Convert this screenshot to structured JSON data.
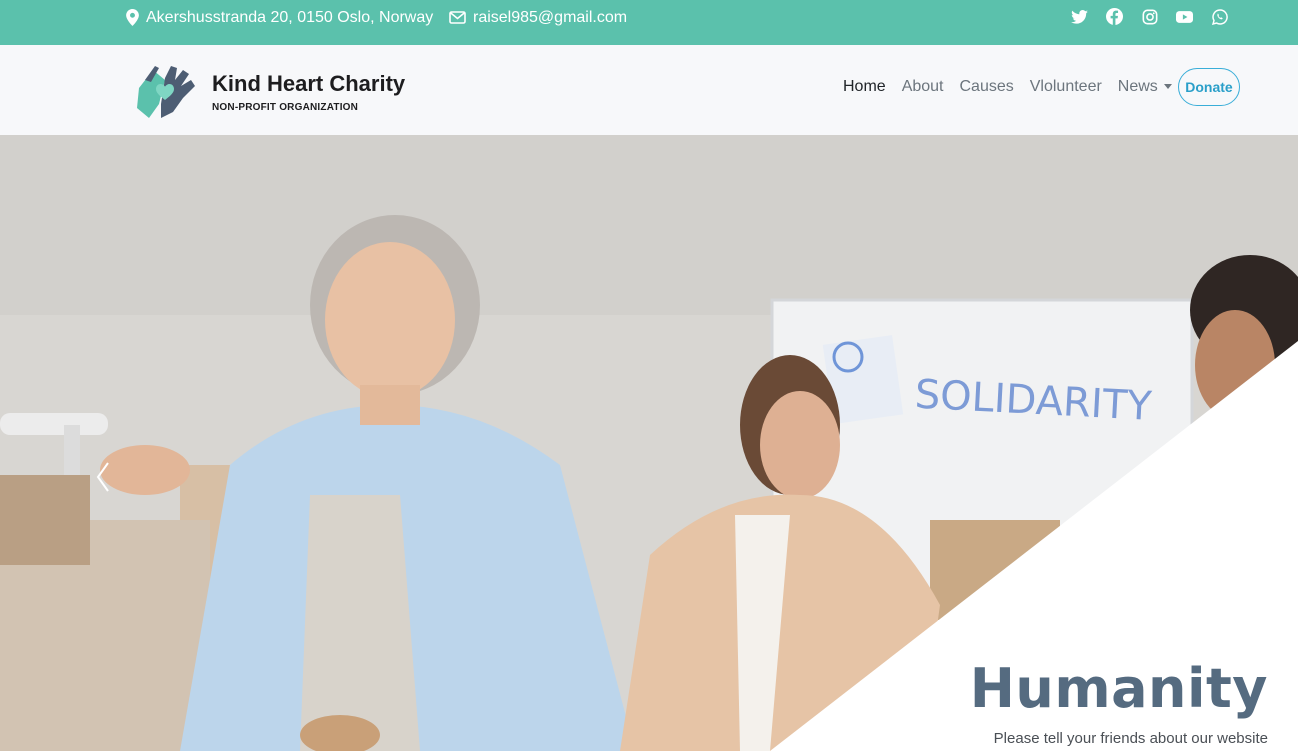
{
  "topbar": {
    "address": "Akershusstranda 20, 0150 Oslo, Norway",
    "email": "raisel985@gmail.com",
    "social_icons": [
      "twitter-icon",
      "facebook-icon",
      "instagram-icon",
      "youtube-icon",
      "whatsapp-icon"
    ]
  },
  "navbar": {
    "brand_name": "Kind Heart Charity",
    "brand_sub": "NON-PROFIT ORGANIZATION",
    "items": [
      {
        "label": "Home",
        "active": true
      },
      {
        "label": "About"
      },
      {
        "label": "Causes"
      },
      {
        "label": "Vlolunteer"
      },
      {
        "label": "News",
        "dropdown": true
      }
    ],
    "donate_label": "Donate"
  },
  "hero": {
    "title": "Humanity",
    "subtitle": "Please tell your friends about our website",
    "board_text": "SOLIDARITY"
  },
  "colors": {
    "topbar": "#5bc1ac",
    "navbar": "#f7f8fa",
    "accent": "#3aaed8",
    "title": "#556b80"
  }
}
